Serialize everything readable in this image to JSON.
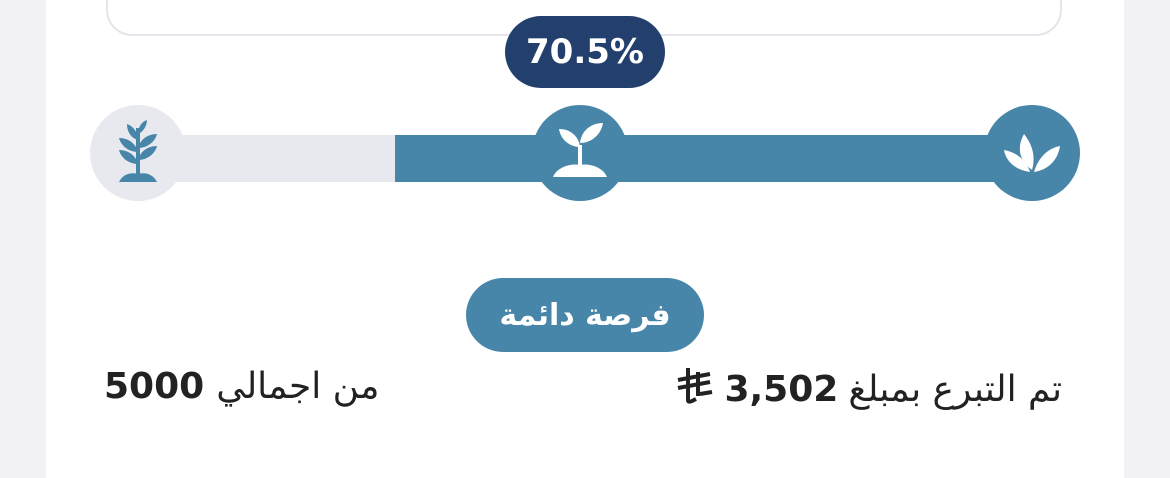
{
  "progress": {
    "percent_label": "70.5%",
    "fraction": 0.705
  },
  "stages": [
    {
      "name": "start",
      "icon": "leaves-icon",
      "state": "active"
    },
    {
      "name": "middle",
      "icon": "sprout-icon",
      "state": "active"
    },
    {
      "name": "end",
      "icon": "plant-icon",
      "state": "inactive"
    }
  ],
  "tag": {
    "label": "فرصة دائمة"
  },
  "donation": {
    "prefix": "تم التبرع بمبلغ",
    "amount": "3,502",
    "currency_icon": "riyal-icon"
  },
  "total": {
    "prefix": "من اجمالي",
    "amount": "5000"
  },
  "colors": {
    "accent": "#4786a8",
    "badge": "#233f6e",
    "track": "#e8e9ee"
  }
}
